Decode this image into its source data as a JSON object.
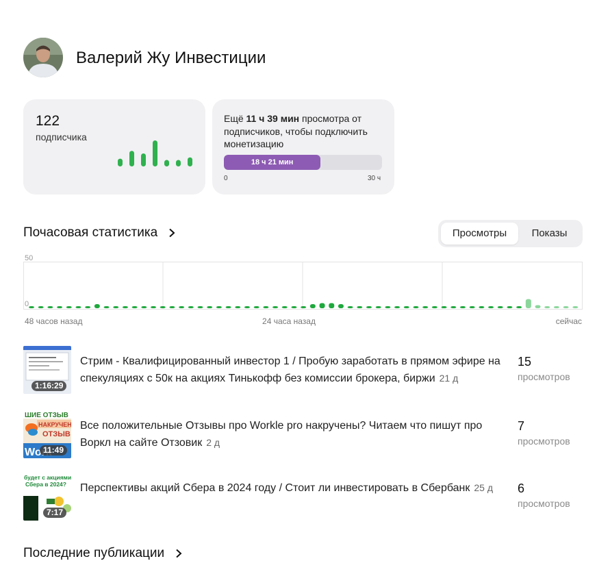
{
  "channel": {
    "name": "Валерий Жу Инвестиции"
  },
  "subscribers": {
    "count": "122",
    "label": "подписчика",
    "trend_bars": [
      0.3,
      0.6,
      0.5,
      1.0,
      0.25,
      0.25,
      0.35
    ]
  },
  "monetization": {
    "prefix": "Ещё ",
    "remaining": "11 ч 39 мин",
    "suffix": " просмотра от подписчиков, чтобы подключить монетизацию",
    "progress_label": "18 ч 21 мин",
    "progress_fraction": 0.6117,
    "min_label": "0",
    "max_label": "30 ч",
    "bar_color": "#8d5bb3"
  },
  "hourly": {
    "title": "Почасовая статистика",
    "toggle": {
      "views": "Просмотры",
      "shows": "Показы",
      "selected": "views"
    }
  },
  "chart_data": {
    "type": "bar",
    "ylim": [
      0,
      50
    ],
    "y_ticks": [
      "50",
      "0"
    ],
    "x_tick_labels": [
      "48 часов назад",
      "24 часа назад",
      "сейчас"
    ],
    "values": [
      1,
      1,
      1,
      1,
      1,
      1,
      1,
      4,
      2,
      1,
      1,
      1,
      1,
      1,
      1,
      1,
      1,
      1,
      1,
      1,
      1,
      1,
      1,
      1,
      1,
      1,
      1,
      1,
      1,
      2,
      4,
      5,
      5,
      4,
      1,
      1,
      1,
      1,
      1,
      1,
      1,
      1,
      1,
      1,
      1,
      1,
      1,
      1,
      1,
      1,
      1,
      1,
      1,
      9,
      3,
      2,
      2,
      2,
      1
    ],
    "colors": {
      "past": "#1fa83d",
      "current": "#8cd69c"
    },
    "current_from_index": 53
  },
  "videos": [
    {
      "title": "Стрим - Квалифицированный инвестор 1 / Пробую заработать в прямом эфире на спекуляциях с 50к на акциях Тинькофф без комиссии брокера, биржи",
      "age": "21 д",
      "duration": "1:16:29",
      "views": "15",
      "views_label": "просмотров"
    },
    {
      "title": "Все положительные Отзывы про Workle pro накручены? Читаем что пишут про Воркл на сайте Отзовик",
      "age": "2 д",
      "duration": "11:49",
      "views": "7",
      "views_label": "просмотров",
      "thumb_text": [
        "ШИЕ ОТЗЫВ",
        "НАКРУЧЕНЫ",
        "ОТЗЫВ",
        "Work"
      ]
    },
    {
      "title": "Перспективы акций Сбера в 2024 году / Стоит ли инвестировать в Сбербанк",
      "age": "25 д",
      "duration": "7:17",
      "views": "6",
      "views_label": "просмотров",
      "thumb_text": [
        "будет с акциями",
        "Сбера в 2024?"
      ]
    }
  ],
  "latest": {
    "title": "Последние публикации"
  }
}
